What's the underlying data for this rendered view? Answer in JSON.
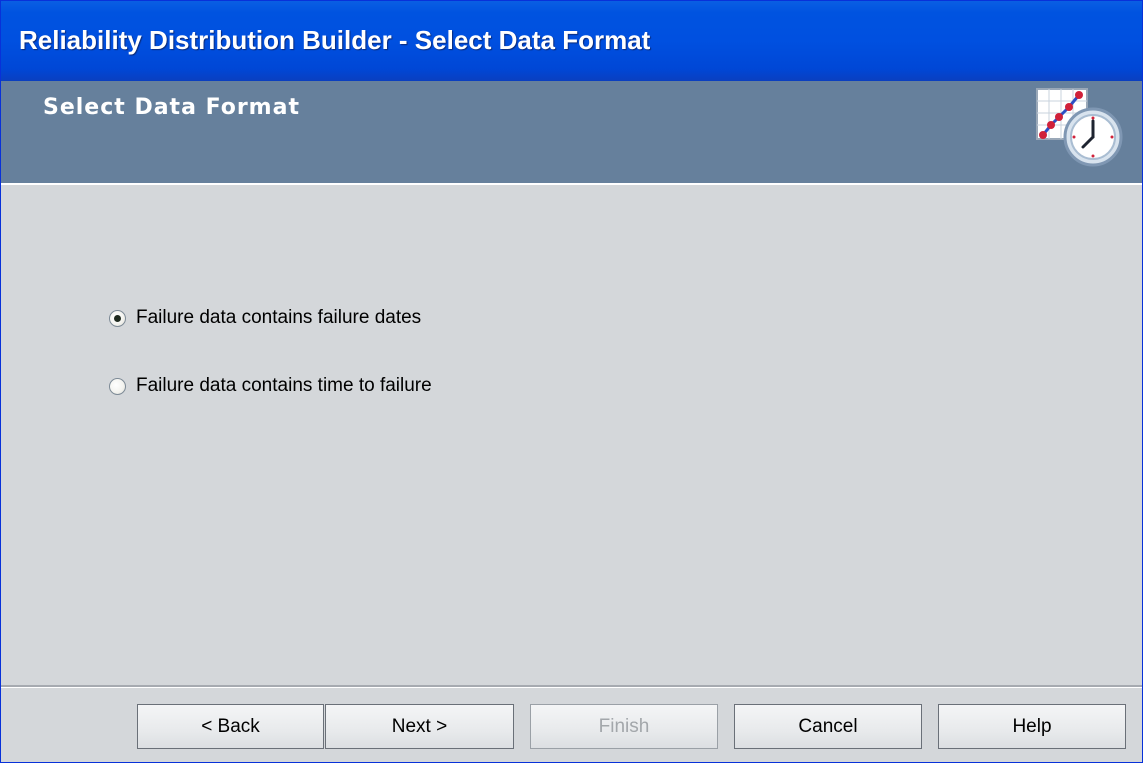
{
  "window": {
    "title": "Reliability Distribution Builder - Select Data Format"
  },
  "header": {
    "title": "Select Data Format",
    "icon": "reliability-chart-clock-icon"
  },
  "options": [
    {
      "label": "Failure data contains failure dates",
      "selected": true
    },
    {
      "label": "Failure data contains time to failure",
      "selected": false
    }
  ],
  "buttons": {
    "back": "< Back",
    "next": "Next >",
    "finish": "Finish",
    "cancel": "Cancel",
    "help": "Help"
  },
  "colors": {
    "titlebar": "#0050e0",
    "header_band": "#66809c",
    "body": "#d4d7da"
  }
}
